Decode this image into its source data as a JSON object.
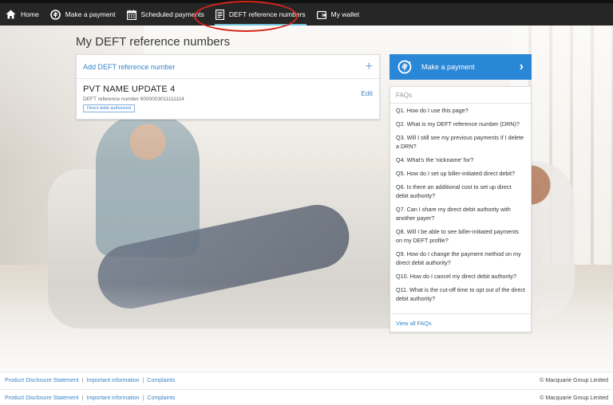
{
  "nav": {
    "items": [
      {
        "label": "Home",
        "icon": "home-icon"
      },
      {
        "label": "Make a payment",
        "icon": "payment-cycle-icon"
      },
      {
        "label": "Scheduled payments",
        "icon": "calendar-icon"
      },
      {
        "label": "DEFT reference numbers",
        "icon": "document-icon",
        "active": true
      },
      {
        "label": "My wallet",
        "icon": "wallet-icon"
      }
    ],
    "active_underline_color": "#6cc1d8",
    "highlight_color": "#d7261b"
  },
  "page": {
    "title": "My DEFT reference numbers"
  },
  "card": {
    "add_label": "Add DEFT reference number",
    "add_icon": "plus-icon",
    "drn": {
      "name": "PVT NAME UPDATE 4",
      "ref_line": "DEFT reference number 6000003011111114",
      "badge": "Direct debit authorised",
      "edit_label": "Edit"
    }
  },
  "sidebar": {
    "pay_button_label": "Make a payment",
    "pay_button_color": "#2a86d6",
    "faq_title": "FAQs",
    "faqs": [
      "Q1. How do I use this page?",
      "Q2. What is my DEFT reference number (DRN)?",
      "Q3. Will I still see my previous payments if I delete a DRN?",
      "Q4. What's the 'nickname' for?",
      "Q5. How do I set up biller-initiated direct debit?",
      "Q6. Is there an additional cost to set up direct debit authority?",
      "Q7. Can I share my direct debit authority with another payer?",
      "Q8. Will I be able to see biller-initiated payments on my DEFT profile?",
      "Q9. How do I change the payment method on my direct debit authority?",
      "Q10. How do I cancel my direct debit authority?",
      "Q11. What is the cut-off time to opt out of the direct debit authority?"
    ],
    "view_all_label": "View all FAQs"
  },
  "footer": {
    "links": [
      "Product Disclosure Statement",
      "Important information",
      "Complaints"
    ],
    "separator": "|",
    "copyright": "© Macquarie Group Limited"
  }
}
